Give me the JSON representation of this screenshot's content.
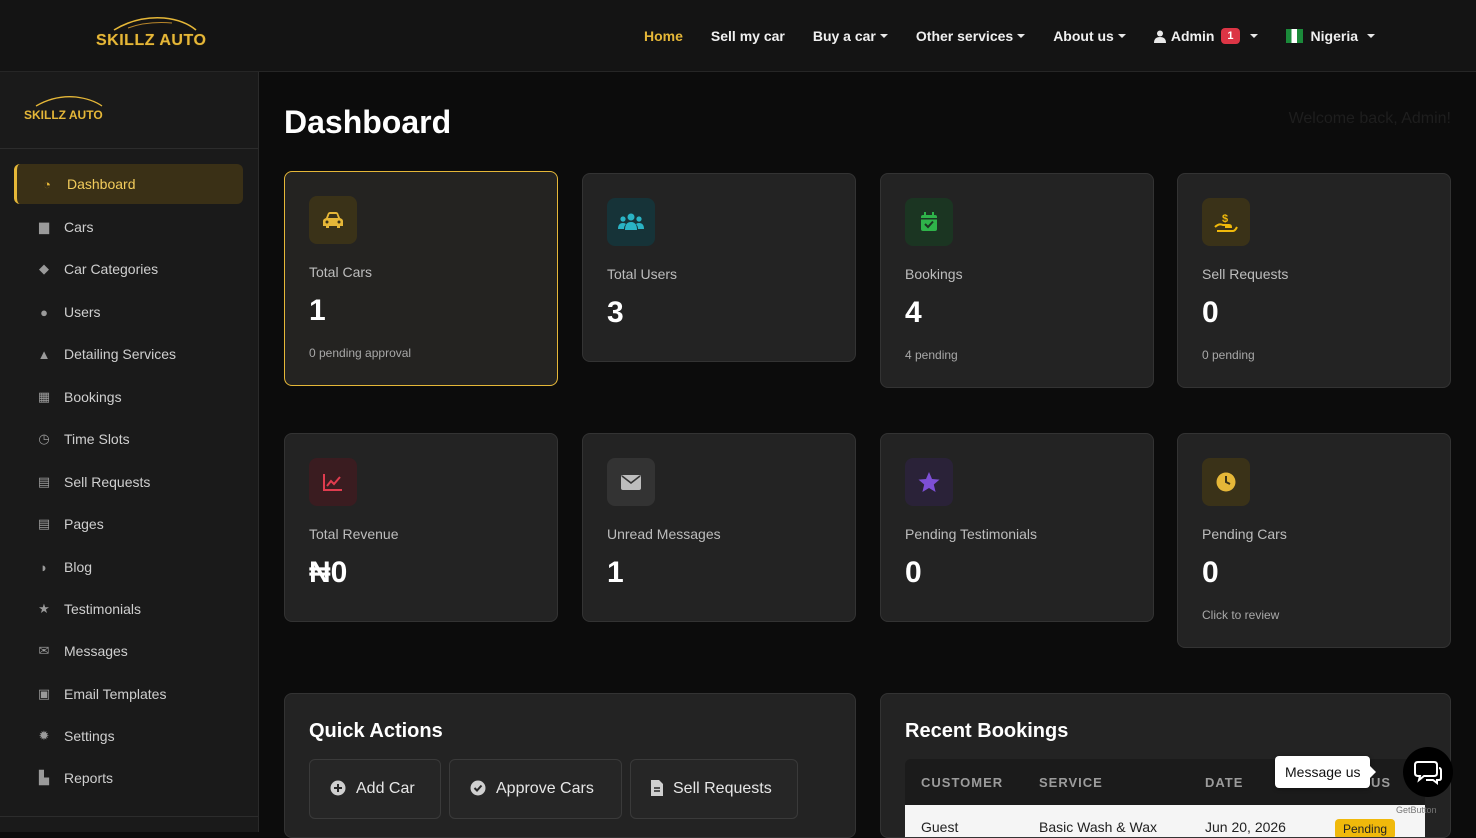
{
  "brand": {
    "name": "SKILLZ AUTO"
  },
  "topnav": {
    "items": [
      {
        "label": "Home",
        "active": true,
        "dropdown": false
      },
      {
        "label": "Sell my car",
        "active": false,
        "dropdown": false
      },
      {
        "label": "Buy a car",
        "active": false,
        "dropdown": true
      },
      {
        "label": "Other services",
        "active": false,
        "dropdown": true
      },
      {
        "label": "About us",
        "active": false,
        "dropdown": true
      }
    ],
    "admin_label": "Admin",
    "admin_badge": "1",
    "country": "Nigeria"
  },
  "sidebar": {
    "items": [
      {
        "label": "Dashboard",
        "icon": "gauge-icon",
        "active": true
      },
      {
        "label": "Cars",
        "icon": "car-icon"
      },
      {
        "label": "Car Categories",
        "icon": "tags-icon"
      },
      {
        "label": "Users",
        "icon": "users-icon"
      },
      {
        "label": "Detailing Services",
        "icon": "spray-icon"
      },
      {
        "label": "Bookings",
        "icon": "calendar-icon"
      },
      {
        "label": "Time Slots",
        "icon": "clock-icon"
      },
      {
        "label": "Sell Requests",
        "icon": "file-icon"
      },
      {
        "label": "Pages",
        "icon": "page-icon"
      },
      {
        "label": "Blog",
        "icon": "blog-icon"
      },
      {
        "label": "Testimonials",
        "icon": "star-icon"
      },
      {
        "label": "Messages",
        "icon": "envelope-icon"
      },
      {
        "label": "Email Templates",
        "icon": "mail-template-icon"
      },
      {
        "label": "Settings",
        "icon": "gear-icon"
      },
      {
        "label": "Reports",
        "icon": "chart-icon"
      }
    ]
  },
  "main": {
    "title": "Dashboard",
    "welcome": "Welcome back, Admin!",
    "stats": [
      {
        "label": "Total Cars",
        "value": "1",
        "sub": "0 pending approval",
        "icon": "car-icon",
        "color": "#e5b738",
        "bg": "#3a3218"
      },
      {
        "label": "Total Users",
        "value": "3",
        "sub": "",
        "icon": "users-icon",
        "color": "#2ab3c4",
        "bg": "#163338"
      },
      {
        "label": "Bookings",
        "value": "4",
        "sub": "4 pending",
        "icon": "calendar-check-icon",
        "color": "#2fb34a",
        "bg": "#1b3522"
      },
      {
        "label": "Sell Requests",
        "value": "0",
        "sub": "0 pending",
        "icon": "hand-dollar-icon",
        "color": "#f0b90b",
        "bg": "#3a3218"
      },
      {
        "label": "Total Revenue",
        "value": "₦0",
        "sub": "",
        "icon": "chart-line-icon",
        "color": "#e03c4f",
        "bg": "#3a1c20"
      },
      {
        "label": "Unread Messages",
        "value": "1",
        "sub": "",
        "icon": "envelope-icon",
        "color": "#bdbdbd",
        "bg": "#333333"
      },
      {
        "label": "Pending Testimonials",
        "value": "0",
        "sub": "",
        "icon": "star-icon",
        "color": "#7d4fd6",
        "bg": "#2a2238"
      },
      {
        "label": "Pending Cars",
        "value": "0",
        "sub": "Click to review",
        "icon": "clock-icon",
        "color": "#e5b738",
        "bg": "#3a3218"
      }
    ],
    "quick_actions": {
      "title": "Quick Actions",
      "buttons": [
        {
          "label": "Add Car",
          "icon": "plus-circle-icon"
        },
        {
          "label": "Approve Cars",
          "icon": "check-circle-icon"
        },
        {
          "label": "Sell Requests",
          "icon": "file-icon"
        }
      ]
    },
    "recent_bookings": {
      "title": "Recent Bookings",
      "columns": [
        "CUSTOMER",
        "SERVICE",
        "DATE",
        "STATUS"
      ],
      "rows": [
        {
          "customer": "Guest",
          "service": "Basic Wash & Wax",
          "date": "Jun 20, 2026",
          "status": "Pending"
        }
      ]
    }
  },
  "chat": {
    "tooltip": "Message us",
    "credit": "GetButton"
  }
}
